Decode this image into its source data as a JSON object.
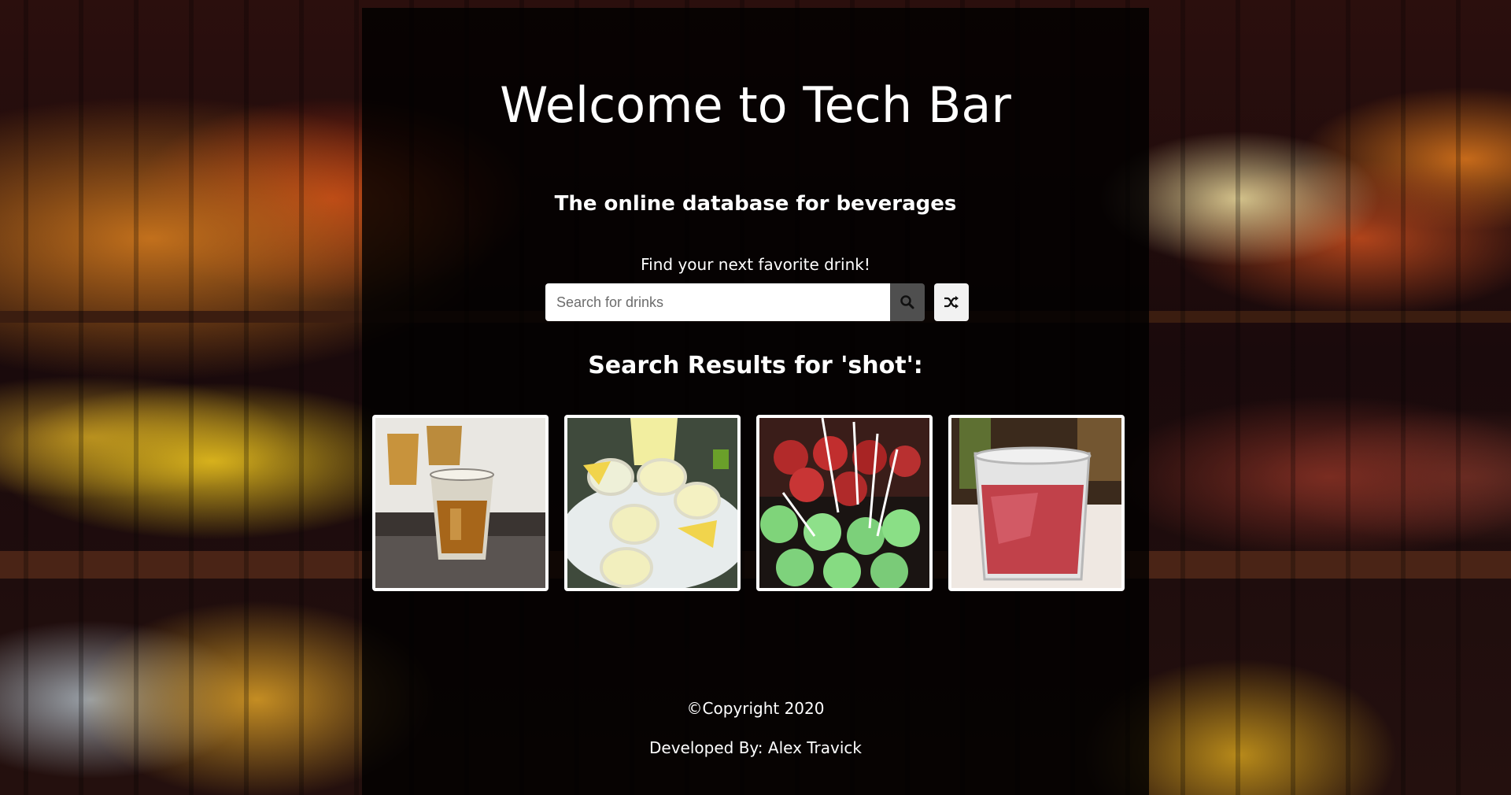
{
  "header": {
    "title": "Welcome to Tech Bar",
    "subtitle": "The online database for beverages",
    "prompt": "Find your next favorite drink!"
  },
  "search": {
    "placeholder": "Search for drinks",
    "value": "",
    "search_icon": "search-icon",
    "random_icon": "shuffle-icon"
  },
  "results": {
    "heading": "Search Results for 'shot':",
    "items": [
      {
        "image": "whiskey-shot-glasses"
      },
      {
        "image": "lemon-drop-shots"
      },
      {
        "image": "green-jello-shots-with-straws"
      },
      {
        "image": "red-cocktail-in-glass"
      }
    ]
  },
  "footer": {
    "copyright": "©Copyright 2020",
    "developer": "Developed By: Alex Travick"
  }
}
